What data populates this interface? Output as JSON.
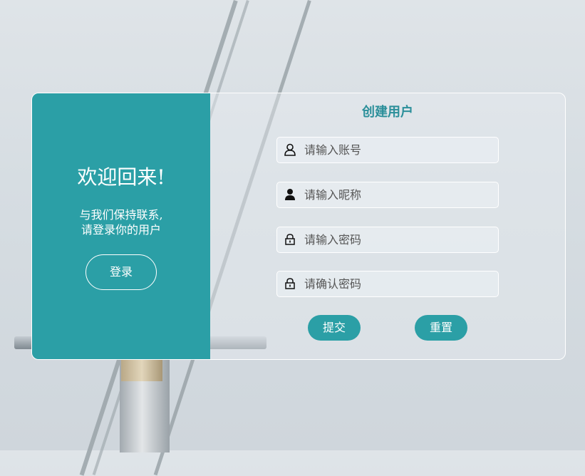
{
  "welcome": {
    "heading": "欢迎回来!",
    "message_line1": "与我们保持联系,",
    "message_line2": "请登录你的用户",
    "login_label": "登录"
  },
  "register": {
    "title": "创建用户",
    "fields": [
      {
        "placeholder": "请输入账号",
        "icon": "user-outline-icon"
      },
      {
        "placeholder": "请输入昵称",
        "icon": "user-filled-icon"
      },
      {
        "placeholder": "请输入密码",
        "icon": "lock-icon"
      },
      {
        "placeholder": "请确认密码",
        "icon": "lock-icon"
      }
    ],
    "submit_label": "提交",
    "reset_label": "重置"
  },
  "colors": {
    "accent": "#2b9fa6",
    "title": "#2b8f9a"
  }
}
